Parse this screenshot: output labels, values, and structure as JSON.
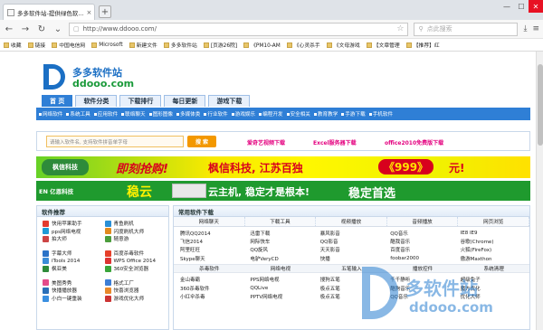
{
  "browser": {
    "tab_title": "多多软件站-提供绿色软...",
    "tab_close": "×",
    "new_tab": "+",
    "window_controls": [
      "—",
      "☐",
      "✕"
    ],
    "url": "http://www.ddooo.com/",
    "search_placeholder": "点此搜索",
    "bookmarks": [
      "收藏",
      "链接",
      "中国电信网",
      "Microsoft",
      "新建文件",
      "多多软件站",
      "[页游26院]",
      "《PM10-AM",
      "《心灵杀手",
      "《文母游戏",
      "【文章管理",
      "【推荐】红"
    ]
  },
  "site": {
    "logo_cn": "多多软件站",
    "logo_en": "ddooo.com",
    "main_nav": [
      "首 页",
      "软件分类",
      "下载排行",
      "每日更新",
      "游戏下载"
    ],
    "sub_nav": [
      "网络软件",
      "系统工具",
      "应用软件",
      "联络聊天",
      "图形图像",
      "多媒体类",
      "行业软件",
      "游戏娱乐",
      "编程开发",
      "安全相关",
      "教育教学",
      "手游下载",
      "手机软件"
    ],
    "search_placeholder": "请输入软件名, 支持软件拼音单字母",
    "search_button": "搜 索",
    "hot_links": [
      "爱奇艺视频下载",
      "Excel服务器下载",
      "office2010免费版下载"
    ],
    "banner1": {
      "logo": "枫信科技",
      "t1": "即刻抢购!",
      "t2": "枫信科技, 江苏百独",
      "t3": "《999》",
      "t4": "元!"
    },
    "banner2": {
      "logo": "EN 亿恩科技",
      "t5": "稳云",
      "t6": "云主机, 稳定才是根本!",
      "t7": "稳定首选"
    }
  },
  "left_panel": {
    "title": "软件推荐",
    "items": [
      {
        "label": "快用苹果助手",
        "color": "#e33b2e"
      },
      {
        "label": "青鱼刷机",
        "color": "#2a8fd6"
      },
      {
        "label": "pps网络电视",
        "color": "#1e9ad6"
      },
      {
        "label": "闪度刷机大师",
        "color": "#e38a1e"
      },
      {
        "label": "拍大师",
        "color": "#c44"
      },
      {
        "label": "随意游",
        "color": "#4b9d3c"
      },
      {
        "sep": true
      },
      {
        "label": "字幕大师",
        "color": "#2b73c8"
      },
      {
        "label": "百度杀毒软件",
        "color": "#e6402a"
      },
      {
        "label": "iTools 2014",
        "color": "#3b8dd8"
      },
      {
        "label": "WPS Office 2014",
        "color": "#d33"
      },
      {
        "label": "枫亚美",
        "color": "#2e8b3a"
      },
      {
        "label": "360安全浏览器",
        "color": "#3aa53a"
      },
      {
        "sep": true
      },
      {
        "label": "美图秀秀",
        "color": "#e44b8a"
      },
      {
        "label": "格式工厂",
        "color": "#3c7ed6"
      },
      {
        "label": "快播播放器",
        "color": "#2a6fb8"
      },
      {
        "label": "快喜浏览器",
        "color": "#e8892a"
      },
      {
        "label": "小白一键重装",
        "color": "#3a8fe0"
      },
      {
        "label": "游戏优化大师",
        "color": "#c33"
      }
    ]
  },
  "right_panel": {
    "title": "常用软件下载",
    "tabs": [
      "网络聊天",
      "下载工具",
      "视频播放",
      "音频播放",
      "网页浏览"
    ],
    "rows": [
      [
        "腾讯QQ2014",
        "迅雷下载",
        "暴风影音",
        "QQ音乐",
        "IE8   IE9"
      ],
      [
        "飞信2014",
        "网际快车",
        "QQ影音",
        "酷我音乐",
        "谷歌(Chrome)"
      ],
      [
        "阿里旺旺",
        "QQ旋风",
        "天天影音",
        "百度音乐",
        "火狐(FireFox)"
      ],
      [
        "Skype聊天",
        "电驴VeryCD",
        "快播",
        "foobar2000",
        "傲游Maxthon"
      ]
    ],
    "band": [
      "杀毒软件",
      "网络电视",
      "五笔输入",
      "播放控件",
      "系统清理"
    ],
    "rows2": [
      [
        "金山毒霸",
        "PPS网络电视",
        "搜狗五笔",
        "千千静听",
        "超级兔子"
      ],
      [
        "360杀毒软件",
        "QQLive",
        "极点五笔",
        "酷狗音乐",
        "魔方优化"
      ],
      [
        "小红伞杀毒",
        "PPTV网络电视",
        "极点五笔",
        "QQ音乐",
        "优化大师"
      ]
    ]
  },
  "watermark": {
    "cn": "多软件站",
    "en": "ddooo.com"
  }
}
